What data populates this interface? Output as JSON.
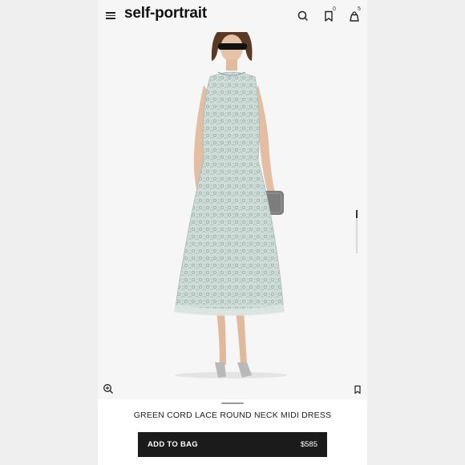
{
  "brand": "self-portrait",
  "header": {
    "menu_icon": "menu-icon",
    "search_icon": "search-icon",
    "wishlist_icon": "bookmark-icon",
    "wishlist_count": "0",
    "bag_icon": "shopping-bag-icon",
    "bag_count": "5"
  },
  "gallery": {
    "zoom_icon": "zoom-in-icon",
    "save_icon": "bookmark-icon"
  },
  "product": {
    "title": "GREEN CORD LACE ROUND NECK MIDI DRESS",
    "add_to_bag_label": "ADD TO BAG",
    "price": "$585"
  },
  "colors": {
    "accent": "#1b1b1b",
    "dress": "#c9d6d2",
    "background": "#f6f6f6"
  }
}
